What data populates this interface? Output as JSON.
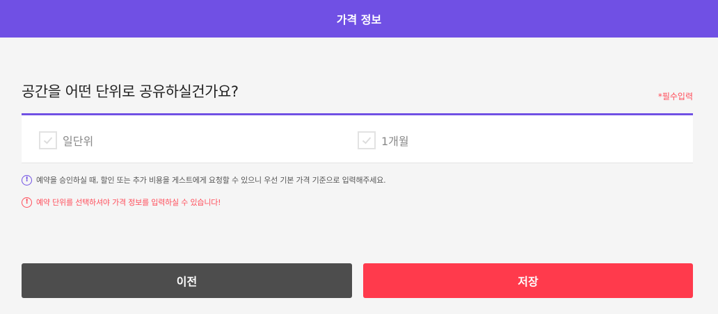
{
  "header": {
    "title": "가격 정보"
  },
  "question": {
    "text": "공간을 어떤 단위로 공유하실건가요?",
    "required_label": "*필수입력"
  },
  "options": [
    {
      "label": "일단위",
      "checked": false
    },
    {
      "label": "1개월",
      "checked": false
    }
  ],
  "notices": {
    "info": {
      "icon": "exclamation-circle-icon",
      "text": "예약을 승인하실 때, 할인 또는 추가 비용을 게스트에게 요청할 수 있으니 우선 기본 가격 기준으로 입력해주세요."
    },
    "warning": {
      "icon": "exclamation-circle-icon",
      "text": "예약 단위를 선택하셔야 가격 정보를 입력하실 수 있습니다!"
    }
  },
  "buttons": {
    "prev_label": "이전",
    "save_label": "저장"
  },
  "colors": {
    "brand": "#7050e4",
    "save": "#ff3a4c",
    "prev": "#4d4d4d",
    "warning": "#ff4d5a"
  }
}
